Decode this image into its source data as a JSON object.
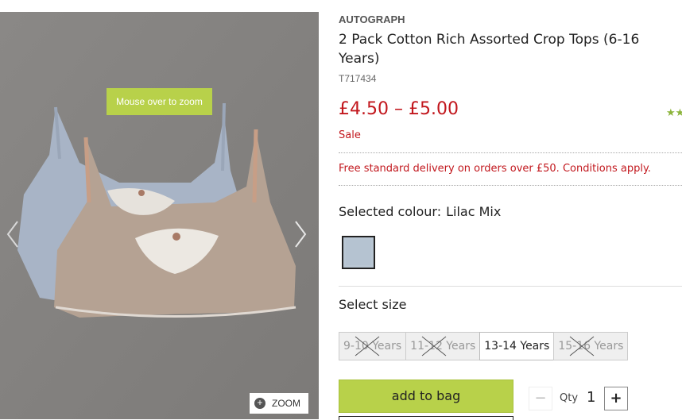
{
  "gallery": {
    "zoom_hint": "Mouse over to zoom",
    "zoom_label": "ZOOM",
    "zoom_plus": "+",
    "prev_icon": "chevron-left-icon",
    "next_icon": "chevron-right-icon"
  },
  "product": {
    "brand": "AUTOGRAPH",
    "title": "2 Pack Cotton Rich Assorted Crop Tops (6-16 Years)",
    "sku": "T717434",
    "price": "£4.50 – £5.00",
    "sale_label": "Sale",
    "rating_icon": "star-icon",
    "delivery": "Free standard delivery on orders over £50. Conditions apply."
  },
  "colour": {
    "label": "Selected colour:",
    "value": "Lilac Mix",
    "swatch_color": "#b9c6d3"
  },
  "size": {
    "label": "Select size",
    "options": [
      {
        "label": "9-10 Years",
        "available": false
      },
      {
        "label": "11-12 Years",
        "available": false
      },
      {
        "label": "13-14 Years",
        "available": true
      },
      {
        "label": "15-16 Years",
        "available": false
      }
    ]
  },
  "actions": {
    "add_to_bag": "add to bag",
    "qty_label": "Qty",
    "qty_value": "1",
    "minus": "−",
    "plus": "+"
  },
  "colors": {
    "accent_green": "#b8d14a",
    "price_red": "#c2171d"
  }
}
